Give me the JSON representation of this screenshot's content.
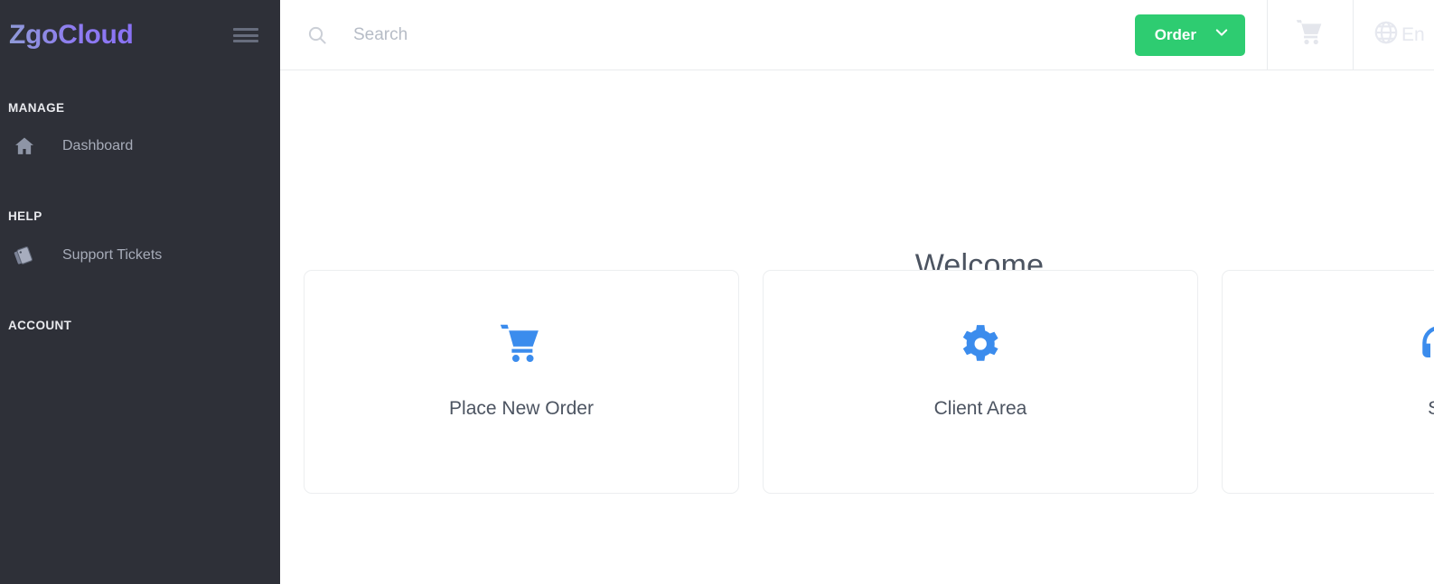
{
  "brand": {
    "name": "ZgoCloud",
    "menu_icon": "hamburger-icon"
  },
  "sidebar": {
    "sections": [
      {
        "label": "MANAGE",
        "items": [
          {
            "label": "Dashboard",
            "icon": "home-icon"
          }
        ]
      },
      {
        "label": "HELP",
        "items": [
          {
            "label": "Support Tickets",
            "icon": "ticket-icon"
          }
        ]
      },
      {
        "label": "ACCOUNT",
        "items": []
      }
    ]
  },
  "topbar": {
    "search": {
      "placeholder": "Search",
      "value": "",
      "icon": "search-icon"
    },
    "order_button": {
      "label": "Order",
      "icon": "chevron-down-icon",
      "color": "#2ecc71"
    },
    "cart": {
      "icon": "shopping-cart-icon"
    },
    "language": {
      "icon": "globe-icon",
      "label": "En"
    }
  },
  "main": {
    "heading": "Welcome",
    "cards": [
      {
        "label": "Place New Order",
        "icon": "shopping-cart-icon",
        "icon_color": "#3b8ced"
      },
      {
        "label": "Client Area",
        "icon": "gear-icon",
        "icon_color": "#3b8ced"
      },
      {
        "label": "Su",
        "icon": "support-icon",
        "icon_color": "#3b8ced"
      }
    ]
  },
  "colors": {
    "sidebar_bg": "#2e3038",
    "accent_green": "#2ecc71",
    "accent_blue": "#3b8ced",
    "brand_gradient_start": "#8f9bd6",
    "brand_gradient_end": "#8a72f5",
    "text_dark": "#4c5461"
  }
}
